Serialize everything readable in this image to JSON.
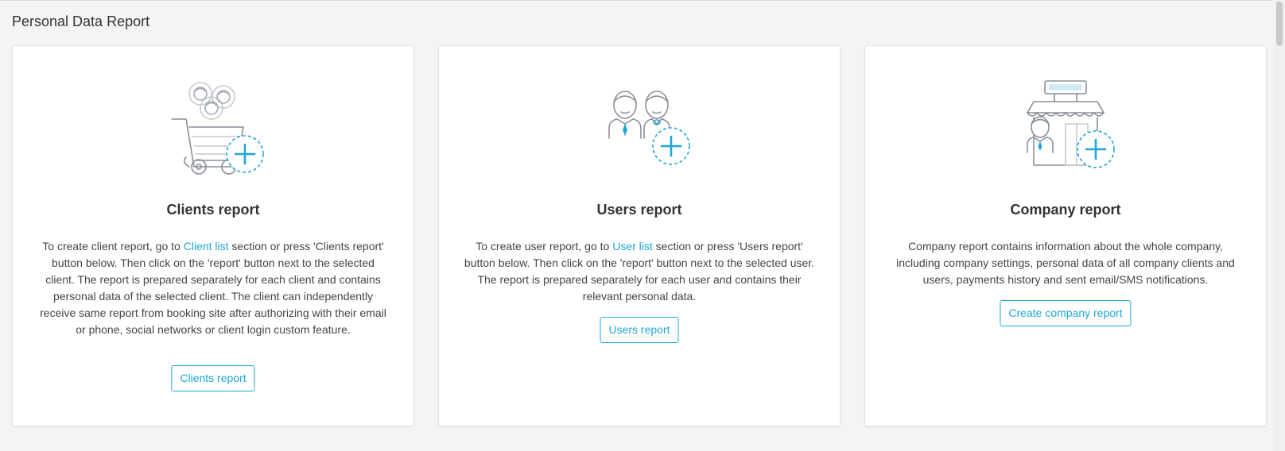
{
  "page": {
    "title": "Personal Data Report"
  },
  "colors": {
    "accent": "#1ea7d8",
    "icon_stroke": "#8a8f99",
    "text": "#333333"
  },
  "cards": [
    {
      "icon": "shopping-cart-with-people-add-icon",
      "title": "Clients report",
      "desc_before": "To create client report, go to ",
      "desc_link": "Client list",
      "desc_after": " section or press 'Clients report' button below. Then click on the 'report' button next to the selected client. The report is prepared separately for each client and contains personal data of the selected client. The client can independently receive same report from booking site after authorizing with their email or phone, social networks or client login custom feature.",
      "button": "Clients report"
    },
    {
      "icon": "two-users-add-icon",
      "title": "Users report",
      "desc_before": "To create user report, go to ",
      "desc_link": "User list",
      "desc_after": " section or press 'Users report' button below. Then click on the 'report' button next to the selected user. The report is prepared separately for each user and contains their relevant personal data.",
      "button": "Users report"
    },
    {
      "icon": "store-with-user-add-icon",
      "title": "Company report",
      "desc": "Company report contains information about the whole company, including company settings, personal data of all company clients and users, payments history and sent email/SMS notifications.",
      "button": "Create company report"
    }
  ]
}
